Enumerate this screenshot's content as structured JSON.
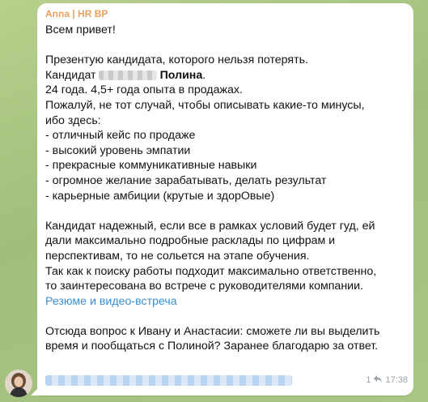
{
  "message": {
    "sender": "Anna | HR BP",
    "greeting": "Всем привет!",
    "intro": "Презентую кандидата, которого нельзя потерять.",
    "candidate_prefix": "Кандидат",
    "candidate_name": "Полина",
    "candidate_suffix": ".",
    "age_exp": "24 года. 4,5+ года опыта в продажах.",
    "intro2_line1": "Пожалуй, не тот случай, чтобы описывать какие-то минусы,",
    "intro2_line2": "ибо здесь:",
    "bullets": [
      "- отличный кейс по продаже",
      "- высокий уровень эмпатии",
      "- прекрасные коммуникативные навыки",
      "- огромное желание зарабатывать, делать результат",
      "- карьерные амбиции (крутые и здорОвые)"
    ],
    "para2_line1": "Кандидат надежный, если все в рамках условий будет гуд, ей",
    "para2_line2": "дали максимально подробные расклады по цифрам и",
    "para2_line3": "перспективам, то не сольется на этапе обучения.",
    "para3_line1": "Так как к поиску работы подходит максимально ответственно,",
    "para3_line2": "то заинтересована во встрече с руководителями компании.",
    "link_text": "Резюме и видео-встреча",
    "question_line1": "Отсюда вопрос к Ивану и Анастасии: сможете ли вы выделить",
    "question_line2": "время и пообщаться с Полиной? Заранее благодарю за ответ.",
    "reply_count": "1",
    "time": "17:38"
  },
  "colors": {
    "sender": "#e7a15d",
    "link": "#3a8fd1",
    "bubble": "#ffffff",
    "background": "#a9c783"
  }
}
